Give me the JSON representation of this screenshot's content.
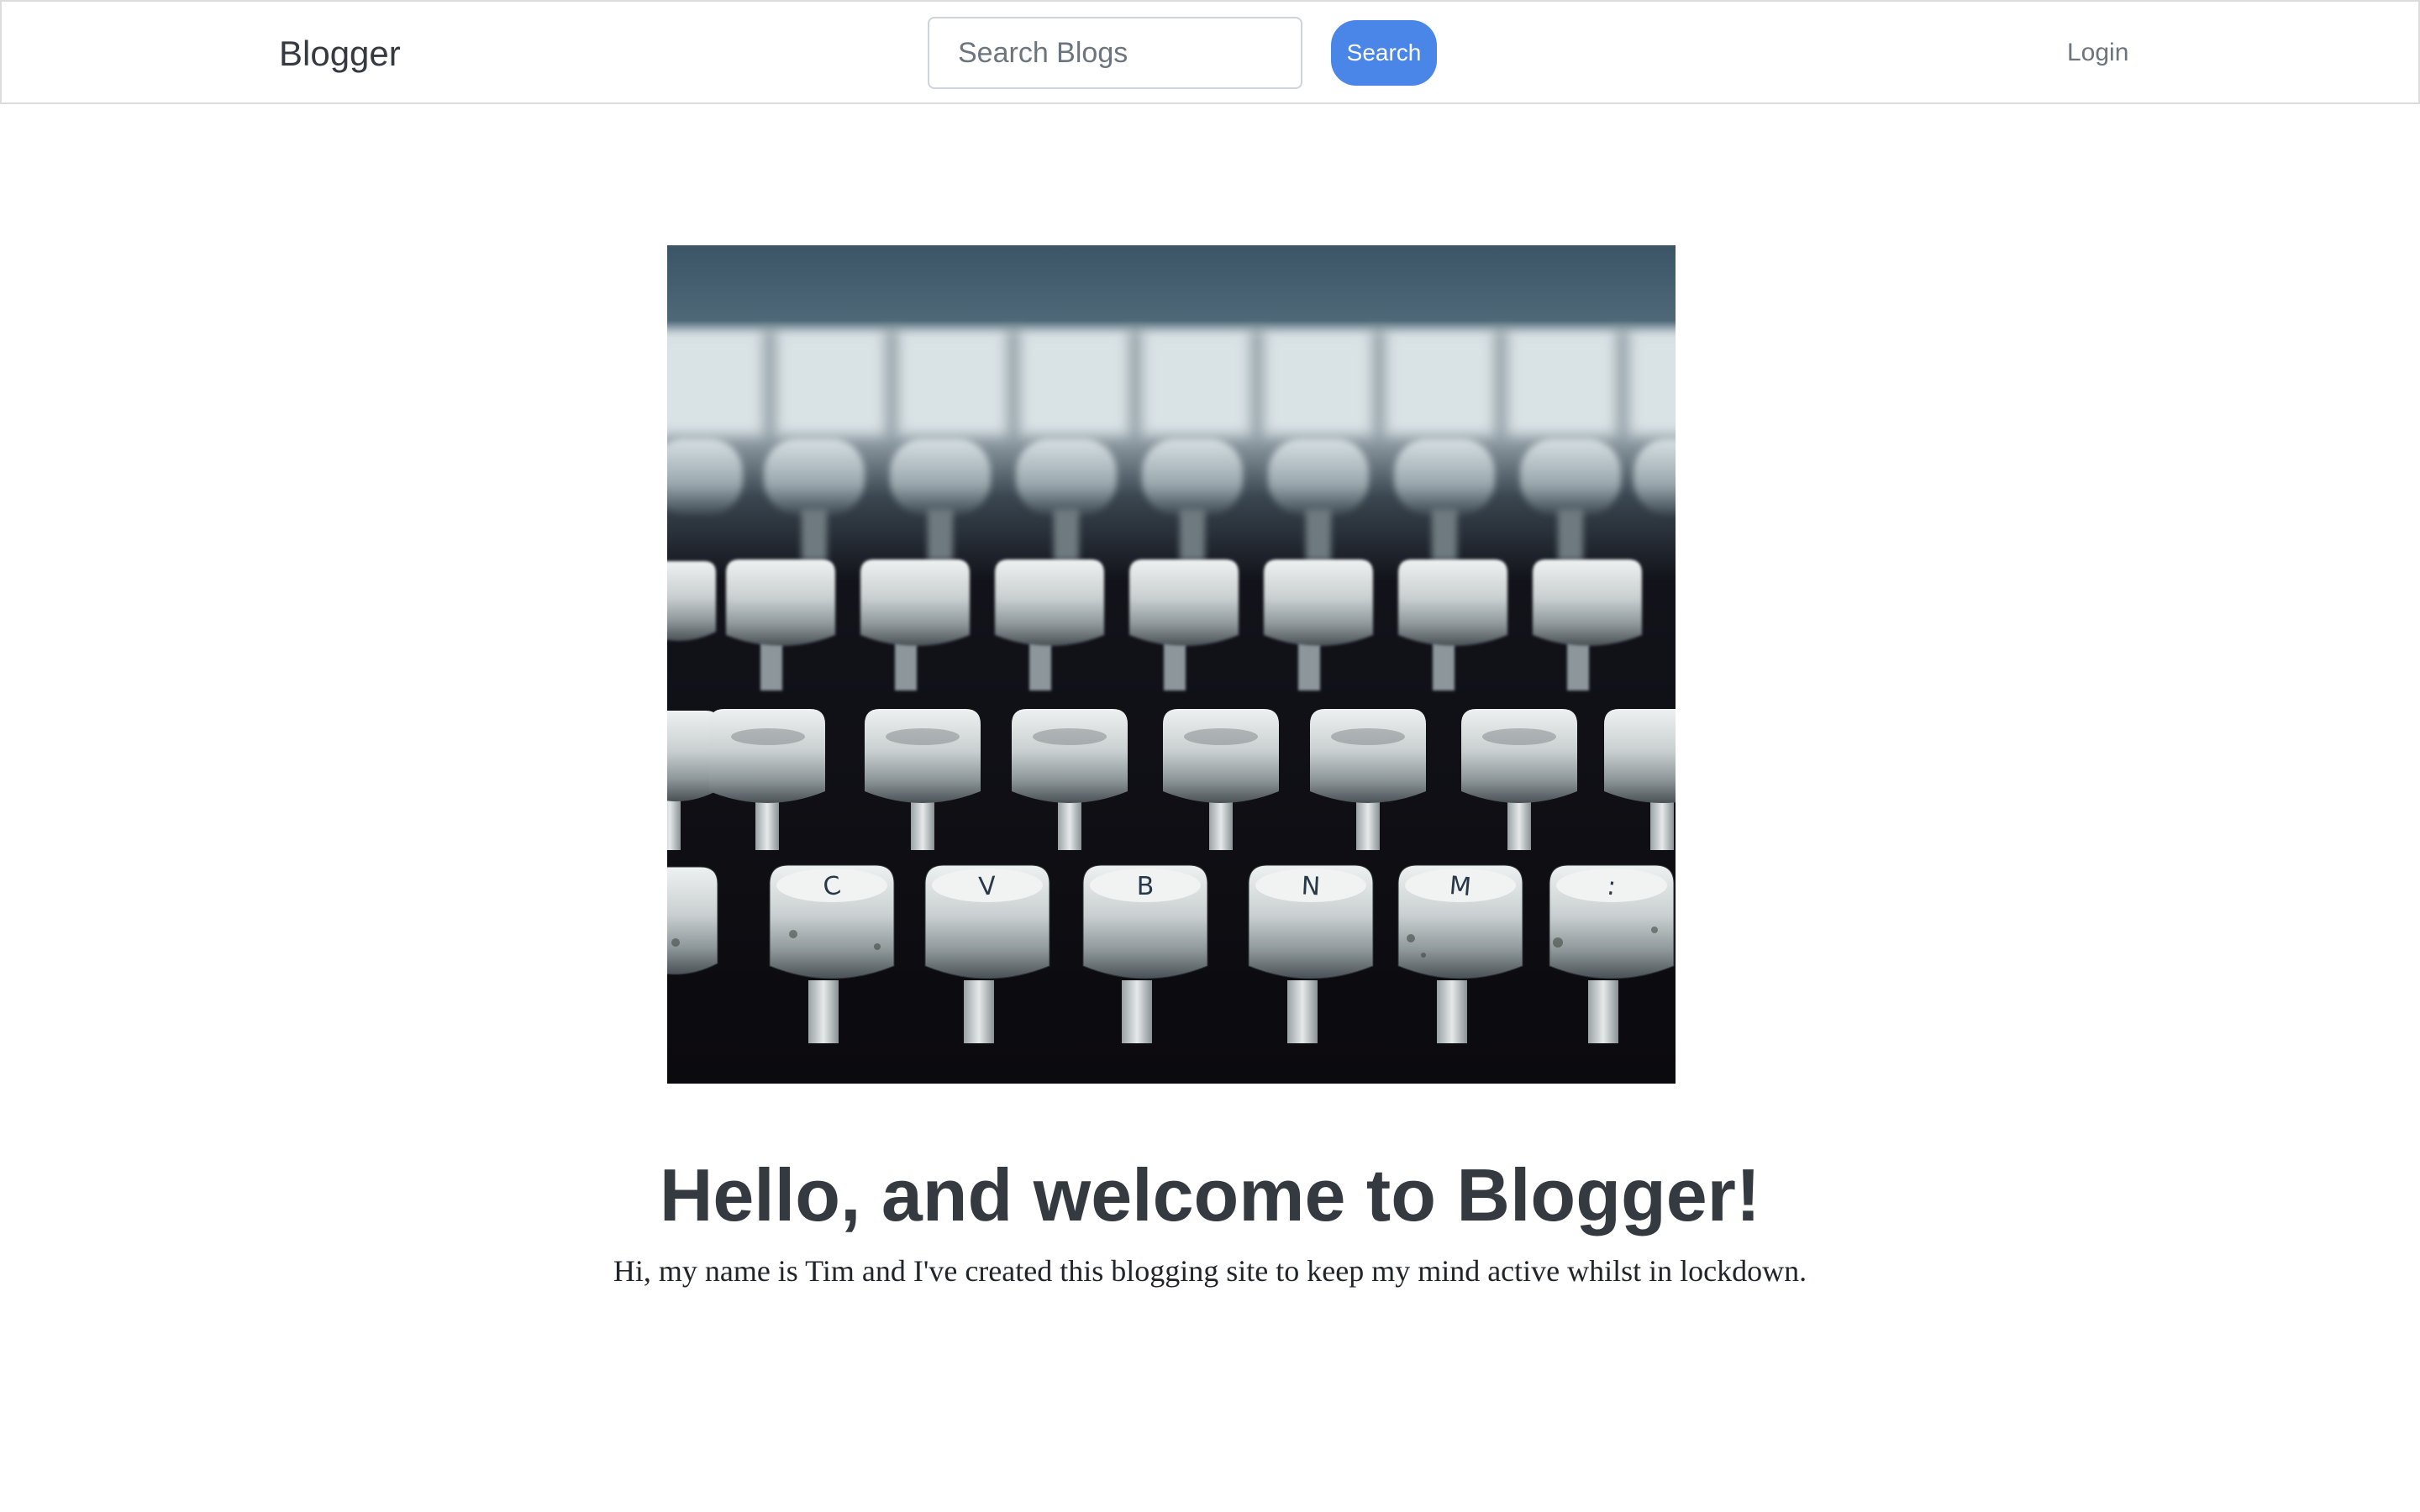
{
  "navbar": {
    "brand": "Blogger",
    "search_placeholder": "Search Blogs",
    "search_value": "",
    "search_button_label": "Search",
    "login_label": "Login",
    "search_button_color": "#4a86e8"
  },
  "hero": {
    "image_subject": "typewriter-keys-photo",
    "key_letters": [
      "C",
      "V",
      "B",
      "N",
      "M"
    ]
  },
  "main": {
    "heading": "Hello, and welcome to Blogger!",
    "intro": "Hi, my name is Tim and I've created this blogging site to keep my mind active whilst in lockdown."
  }
}
